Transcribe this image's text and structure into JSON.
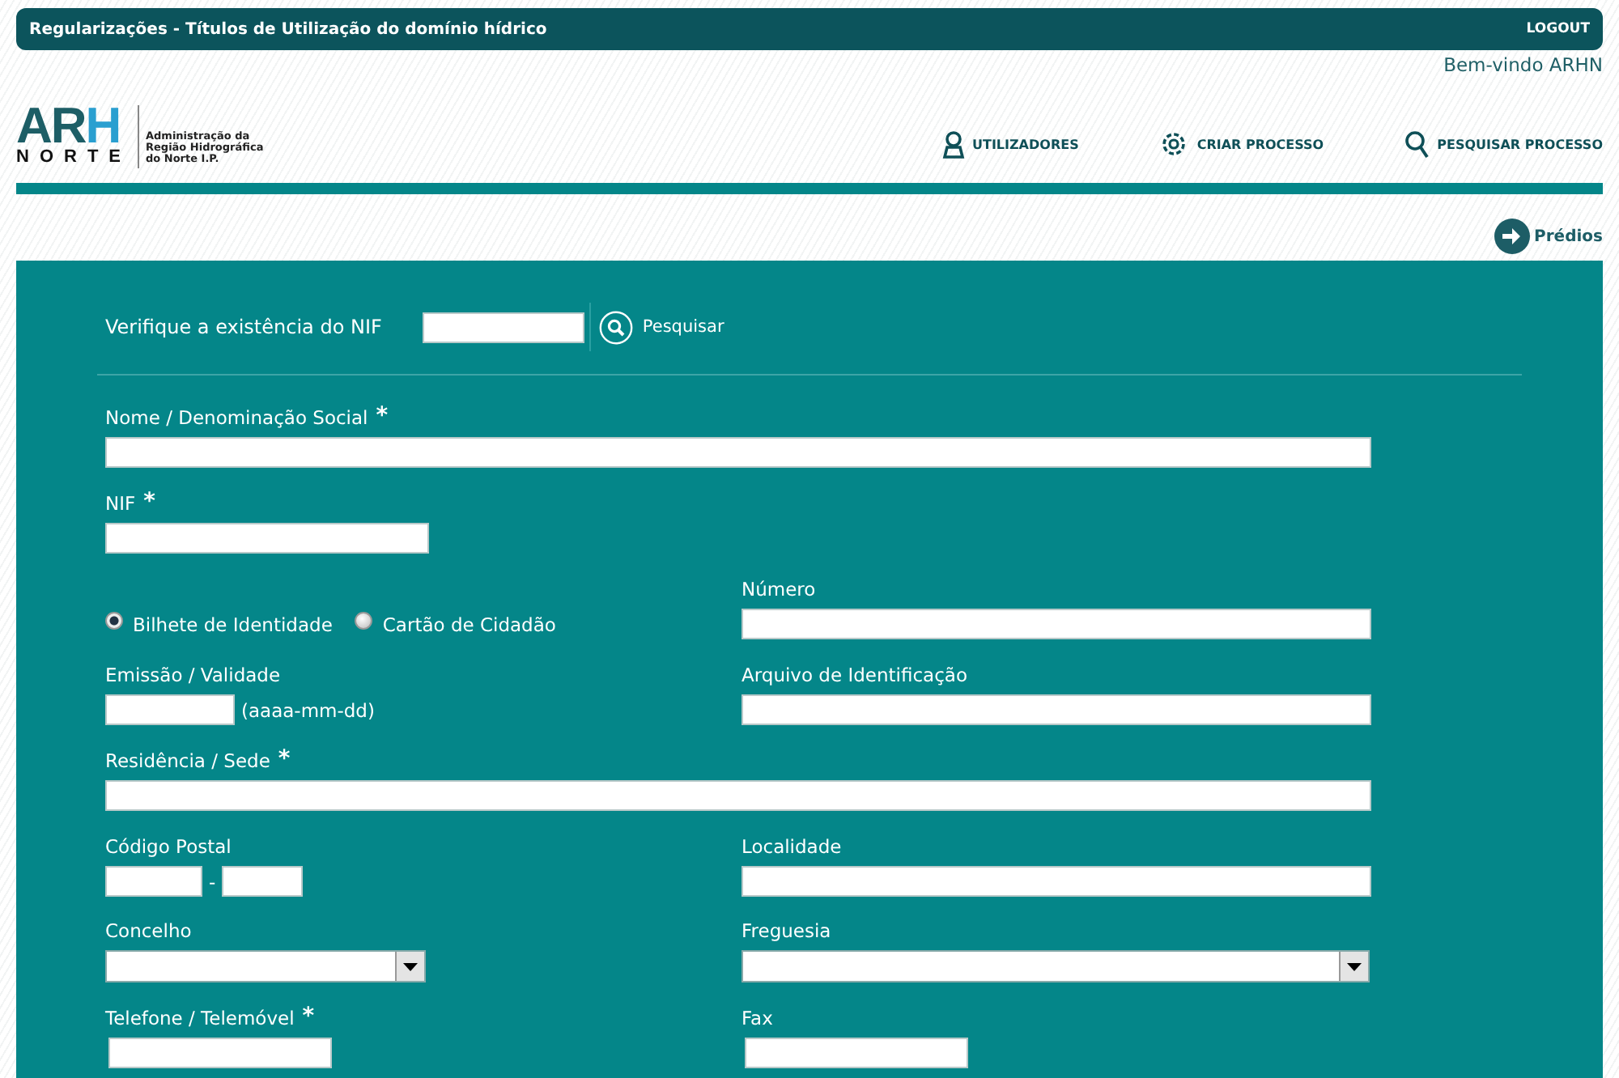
{
  "top_bar": {
    "title": "Regularizações - Títulos de Utilização do domínio hídrico",
    "logout": "LOGOUT"
  },
  "welcome": "Bem-vindo ARHN",
  "logo": {
    "mark_top_left": "AR",
    "mark_top_right": "H",
    "mark_bottom": "NORTE",
    "text": [
      "Administração da",
      "Região Hidrográfica",
      "do Norte I.P."
    ]
  },
  "nav": [
    {
      "kind": "user",
      "label": "UTILIZADORES"
    },
    {
      "kind": "gear",
      "label": "CRIAR PROCESSO"
    },
    {
      "kind": "search",
      "label": "PESQUISAR PROCESSO"
    }
  ],
  "next_link": "Prédios",
  "nif_check": {
    "label": "Verifique a existência do NIF",
    "button": "Pesquisar"
  },
  "rows": [
    [
      {
        "kind": "text_full",
        "label": "Nome / Denominação Social",
        "required_mark": "*"
      }
    ],
    [
      {
        "kind": "text_short",
        "label": "NIF",
        "required_mark": "*"
      }
    ],
    [
      {
        "kind": "radio",
        "options": [
          {
            "label": "Bilhete de Identidade",
            "selected": true
          },
          {
            "label": "Cartão de Cidadão",
            "selected": false
          }
        ]
      },
      {
        "kind": "text_half",
        "label": "Número"
      }
    ],
    [
      {
        "kind": "date",
        "label": "Emissão / Validade",
        "hint": "(aaaa-mm-dd)"
      },
      {
        "kind": "text_half",
        "label": "Arquivo de Identificação"
      }
    ],
    [
      {
        "kind": "text_full",
        "label": "Residência / Sede",
        "required_mark": "*"
      }
    ],
    [
      {
        "kind": "postal",
        "label": "Código Postal",
        "separator": "-"
      },
      {
        "kind": "text_half",
        "label": "Localidade"
      }
    ],
    [
      {
        "kind": "select",
        "label": "Concelho"
      },
      {
        "kind": "select_half",
        "label": "Freguesia"
      }
    ],
    [
      {
        "kind": "text_short",
        "label": "Telefone / Telemóvel",
        "required_mark": "*"
      },
      {
        "kind": "text_short",
        "label": "Fax"
      }
    ]
  ]
}
